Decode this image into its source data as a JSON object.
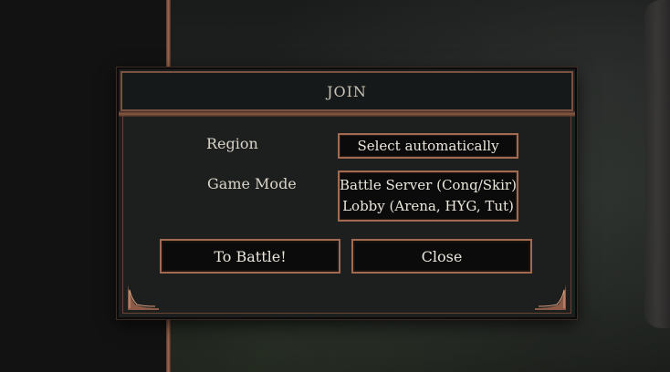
{
  "dialog": {
    "title": "JOIN",
    "region_label": "Region",
    "region_value": "Select automatically",
    "game_mode_label": "Game Mode",
    "game_mode_options": [
      "Battle Server (Conq/Skir)",
      "Lobby (Arena, HYG, Tut)"
    ],
    "battle_button": "To Battle!",
    "close_button": "Close"
  },
  "colors": {
    "accent_border": "#a26a50",
    "dialog_bg": "#1d1f1e",
    "control_bg": "#0b0b0b",
    "text": "#ece7dc"
  }
}
